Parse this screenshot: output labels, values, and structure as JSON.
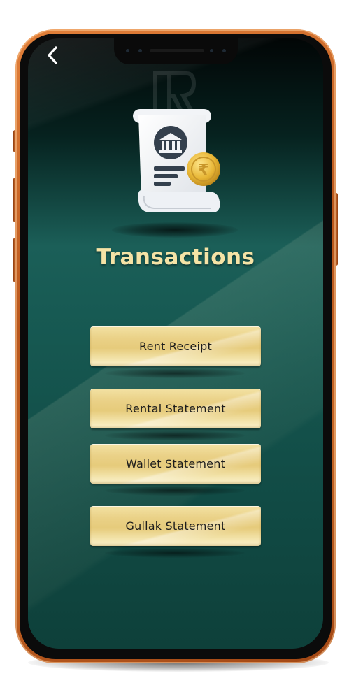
{
  "header": {
    "back_icon": "chevron-left-icon"
  },
  "illustration": {
    "icon": "receipt-bank-rupee-icon",
    "coin_symbol": "₹"
  },
  "page": {
    "title": "Transactions"
  },
  "menu": {
    "items": [
      {
        "label": "Rent Receipt"
      },
      {
        "label": "Rental Statement"
      },
      {
        "label": "Wallet Statement"
      },
      {
        "label": "Gullak Statement"
      }
    ]
  },
  "colors": {
    "frame": "#c46424",
    "screen_top": "#020606",
    "screen_mid": "#1b5f58",
    "screen_bottom": "#0e403a",
    "title": "#f5e3a6",
    "button_gold": "#ead187",
    "button_text": "#1c1c1c"
  }
}
